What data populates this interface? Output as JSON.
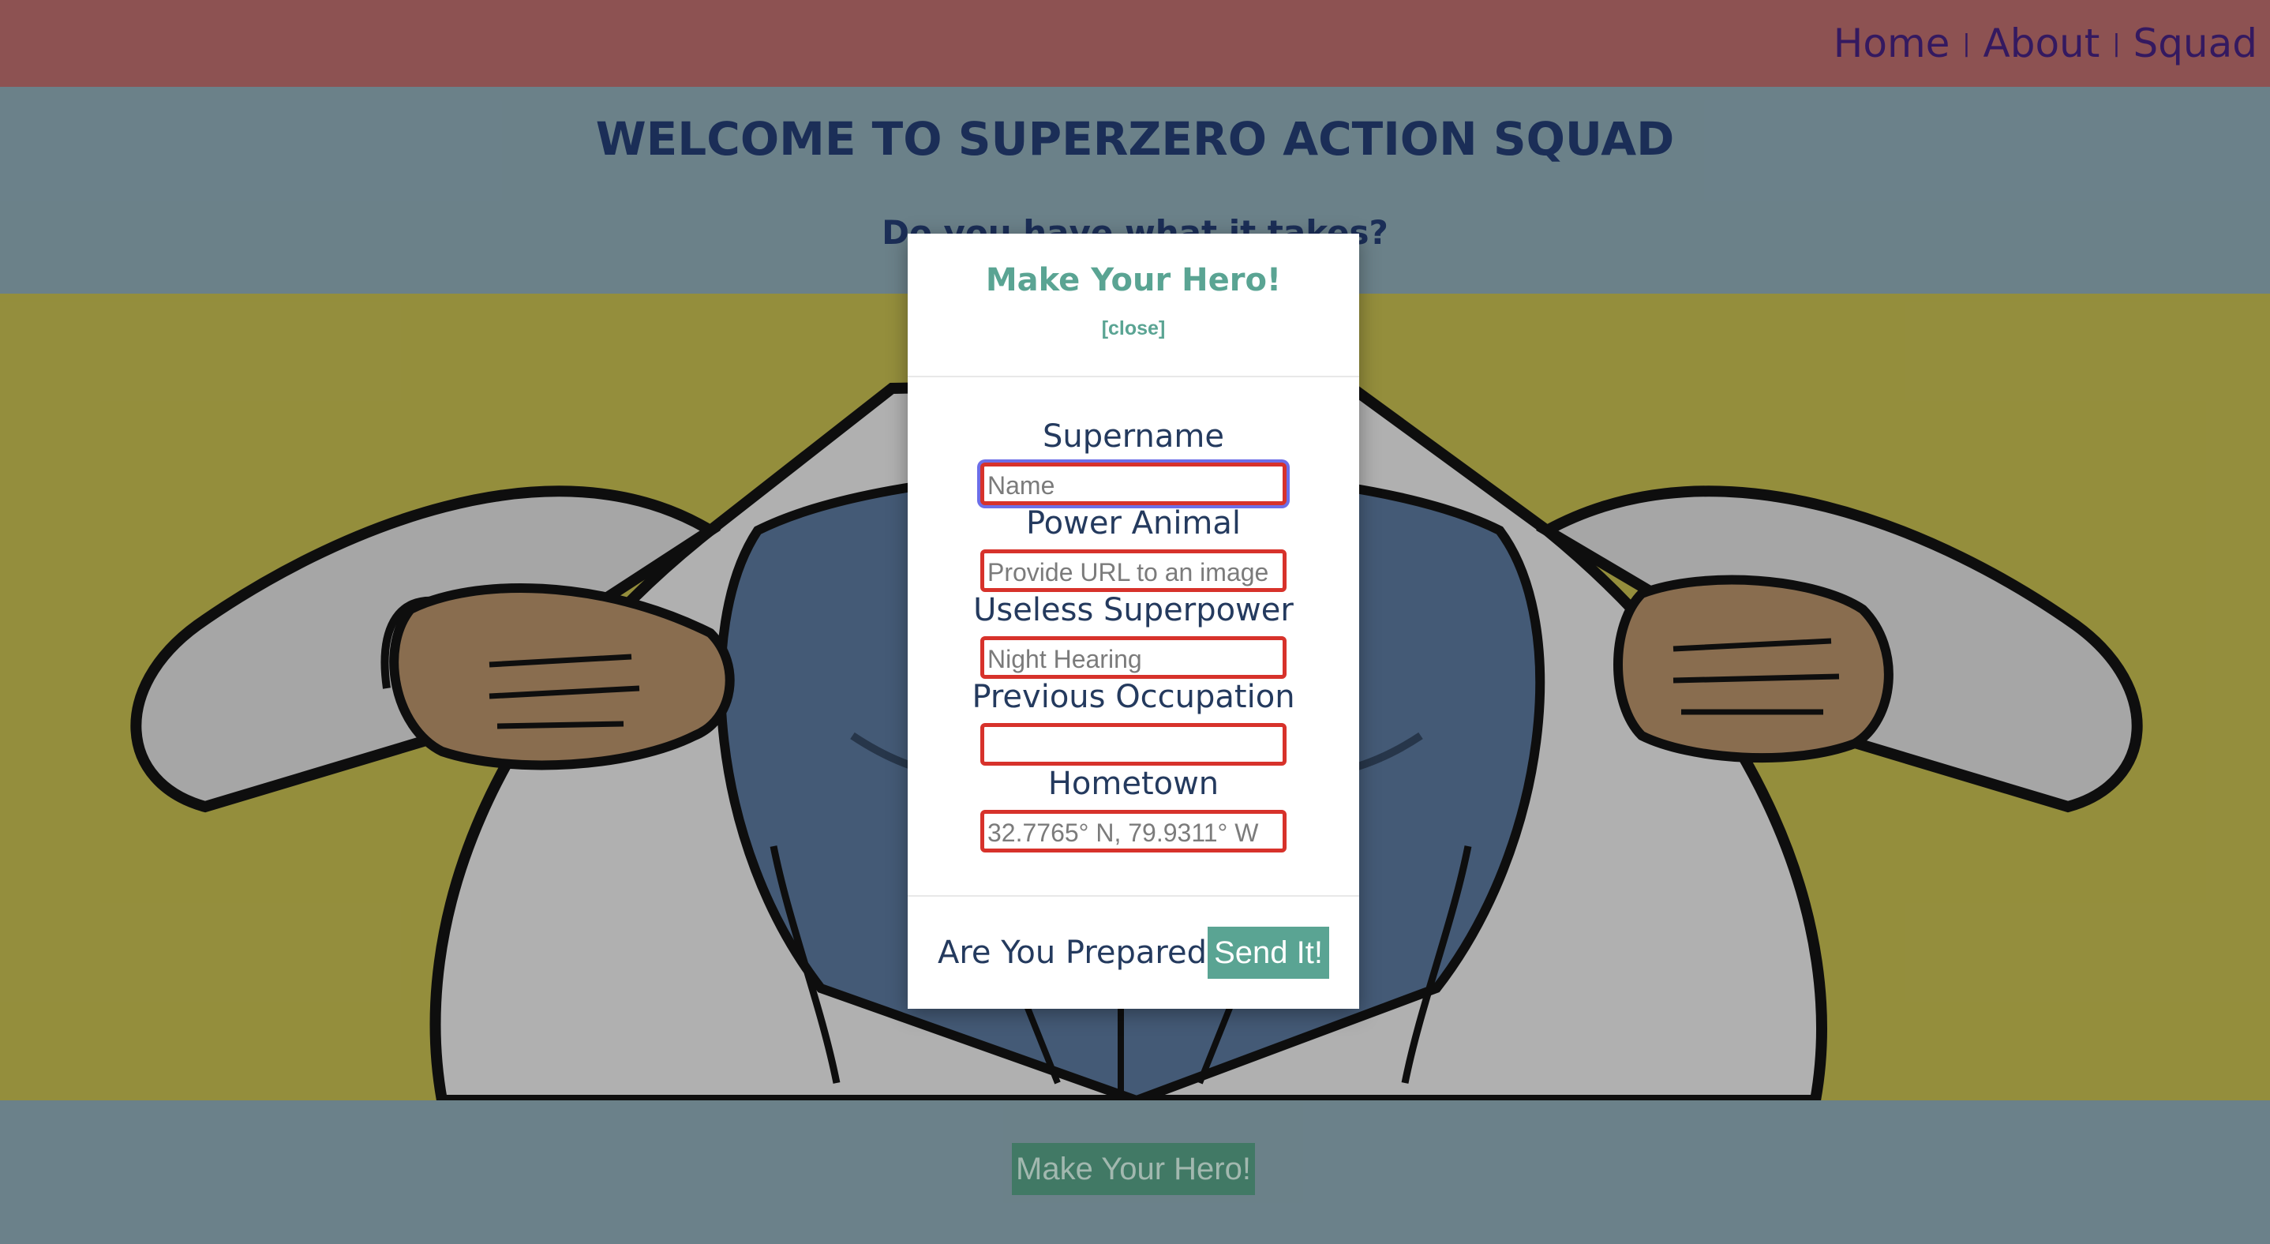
{
  "nav": {
    "home": "Home",
    "about": "About",
    "squad": "Squad",
    "separator": "|"
  },
  "welcome": {
    "title": "WELCOME TO SUPERZERO ACTION SQUAD",
    "tagline": "Do you have what it takes?"
  },
  "hero_image": {
    "description_icon": "superhero-shirt-rip-illustration"
  },
  "footer": {
    "open_modal_label": "Make Your Hero!"
  },
  "modal": {
    "title": "Make Your Hero!",
    "close_label": "[close]",
    "fields": [
      {
        "label": "Supername",
        "placeholder": "Name",
        "value": ""
      },
      {
        "label": "Power Animal",
        "placeholder": "Provide URL to an image",
        "value": ""
      },
      {
        "label": "Useless Superpower",
        "placeholder": "Night Hearing",
        "value": ""
      },
      {
        "label": "Previous Occupation",
        "placeholder": "",
        "value": ""
      },
      {
        "label": "Hometown",
        "placeholder": "32.7765° N, 79.9311° W",
        "value": ""
      }
    ],
    "prepared_text": "Are You Prepared?",
    "send_label": "Send It!"
  },
  "colors": {
    "navbar": "#a15e5e",
    "band": "#7a939d",
    "hero_bg": "#a9a245",
    "accent": "#5aa493",
    "input_border": "#d7322b",
    "focus_ring": "#6d6ee8"
  }
}
